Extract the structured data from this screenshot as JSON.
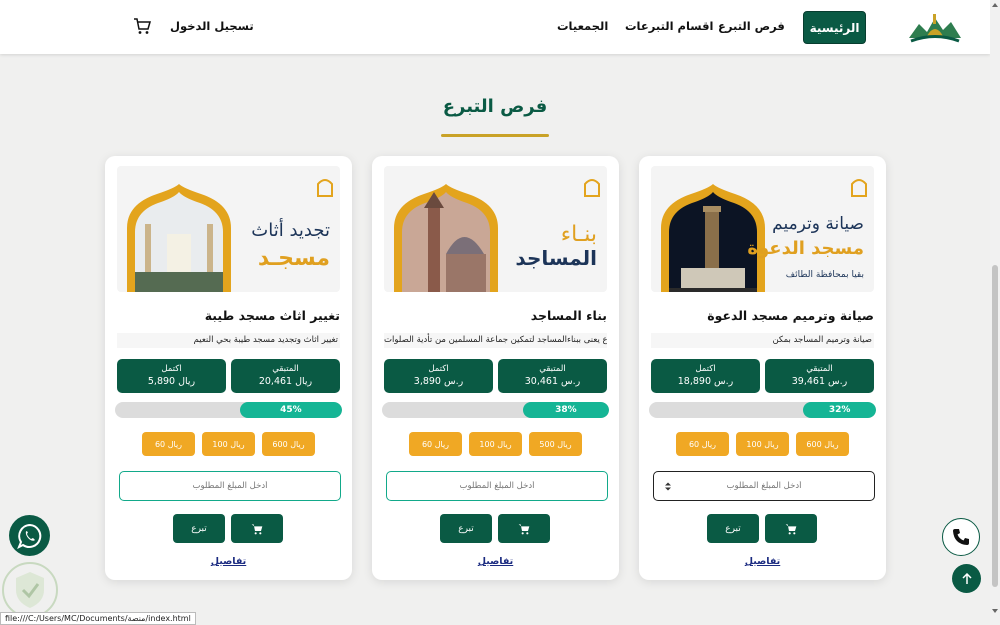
{
  "nav": {
    "home": "الرئيسية",
    "links": [
      "فرص التبرع",
      "اقسام التبرعات",
      "الجمعيات"
    ],
    "login": "تسجيل الدخول"
  },
  "section": {
    "title": "فرص التبرع"
  },
  "cards": [
    {
      "banner": {
        "line1": "صيانة وترميم",
        "line2": "مسجد الدعوة",
        "line3": "بقيا بمحافظة الطائف"
      },
      "title": "صيانة وترميم مسجد الدعوة",
      "desc": "صيانة وترميم المساجد بمكن",
      "remaining_label": "المتبقي",
      "remaining_value": "39,461 ر.س",
      "completed_label": "اكتمل",
      "completed_value": "18,890 ر.س",
      "progress_percent": 32,
      "progress_text": "32%",
      "amounts": [
        "600 ريال",
        "100 ريال",
        "60 ريال"
      ],
      "input_placeholder": "أدخل المبلغ المطلوب",
      "donate": "تبرع",
      "details": "تفاصيل"
    },
    {
      "banner": {
        "line1": "بنـاء",
        "line2": "المساجد"
      },
      "title": "بناء المساجد",
      "desc": "مشروع يعنى ببناءالمساجد لتمكين جماعة المسلمين من تأدية الصلوات",
      "remaining_label": "المتبقي",
      "remaining_value": "30,461 ر.س",
      "completed_label": "اكتمل",
      "completed_value": "3,890 ر.س",
      "progress_percent": 38,
      "progress_text": "38%",
      "amounts": [
        "500 ريال",
        "100 ريال",
        "60 ريال"
      ],
      "input_placeholder": "أدخل المبلغ المطلوب",
      "donate": "تبرع",
      "details": "تفاصيل"
    },
    {
      "banner": {
        "line1": "تجديد أثاث",
        "line2": "مسجـد"
      },
      "title": "تغيير اثاث مسجد طيبة",
      "desc": "تغيير اثاث وتجديد مسجد طيبة بحي النعيم",
      "remaining_label": "المتبقي",
      "remaining_value": "20,461 ريال",
      "completed_label": "اكتمل",
      "completed_value": "5,890 ريال",
      "progress_percent": 45,
      "progress_text": "45%",
      "amounts": [
        "600 ريال",
        "100 ريال",
        "60 ريال"
      ],
      "input_placeholder": "أدخل المبلغ المطلوب",
      "donate": "تبرع",
      "details": "تفاصيل"
    }
  ],
  "statusbar": "file:///C:/Users/MC/Documents/منصة/index.html",
  "colors": {
    "primary": "#0a5a44",
    "accent": "#f0a824",
    "progress": "#15b595",
    "gold": "#c9a227"
  }
}
